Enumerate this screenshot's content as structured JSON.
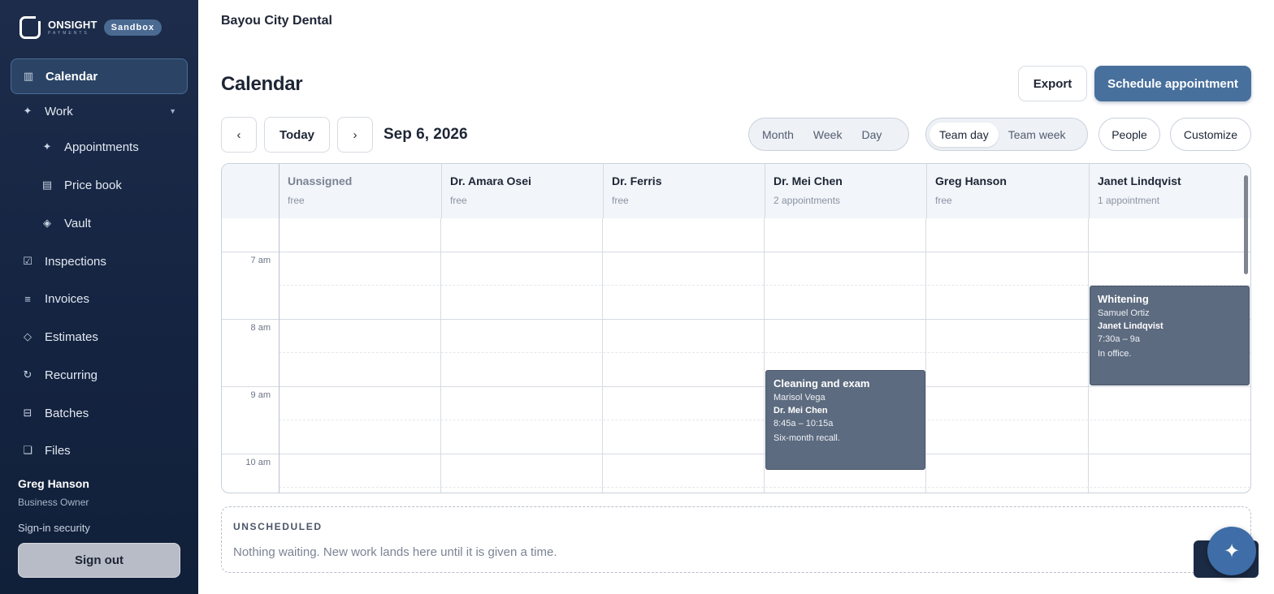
{
  "sidebar": {
    "brand": {
      "name": "ONSIGHT",
      "sub": "PAYMENTS",
      "badge": "Sandbox"
    },
    "items": [
      {
        "label": "Calendar",
        "icon": "calendar-icon"
      },
      {
        "label": "Work",
        "icon": "sparkle-icon"
      },
      {
        "label": "Appointments",
        "icon": "sparkle-icon"
      },
      {
        "label": "Price book",
        "icon": "book-icon"
      },
      {
        "label": "Vault",
        "icon": "diamond-icon"
      },
      {
        "label": "Inspections",
        "icon": "checkbox-icon"
      },
      {
        "label": "Invoices",
        "icon": "list-icon"
      },
      {
        "label": "Estimates",
        "icon": "diamond-outline-icon"
      },
      {
        "label": "Recurring",
        "icon": "refresh-icon"
      },
      {
        "label": "Batches",
        "icon": "batch-icon"
      },
      {
        "label": "Files",
        "icon": "file-icon"
      }
    ],
    "user": {
      "name": "Greg Hanson",
      "role": "Business Owner"
    },
    "sign_in_security": "Sign-in security",
    "sign_out": "Sign out"
  },
  "header": {
    "org": "Bayou City Dental"
  },
  "page": {
    "title": "Calendar",
    "export_label": "Export",
    "schedule_label": "Schedule appointment"
  },
  "toolbar": {
    "prev": "‹",
    "today": "Today",
    "next": "›",
    "date": "Sep 6, 2026",
    "views": [
      "Month",
      "Week",
      "Day"
    ],
    "team_views": [
      "Team day",
      "Team week"
    ],
    "active_team_view": "Team day",
    "people": "People",
    "customize": "Customize"
  },
  "calendar": {
    "columns": [
      {
        "name": "Unassigned",
        "status": "free"
      },
      {
        "name": "Dr. Amara Osei",
        "status": "free"
      },
      {
        "name": "Dr. Ferris",
        "status": "free"
      },
      {
        "name": "Dr. Mei Chen",
        "status": "2 appointments"
      },
      {
        "name": "Greg Hanson",
        "status": "free"
      },
      {
        "name": "Janet Lindqvist",
        "status": "1 appointment"
      }
    ],
    "times": [
      "7 am",
      "8 am",
      "9 am",
      "10 am"
    ],
    "appointments": [
      {
        "title": "Whitening",
        "client": "Samuel Ortiz",
        "provider": "Janet Lindqvist",
        "time": "7:30a – 9a",
        "note": "In office."
      },
      {
        "title": "Cleaning and exam",
        "client": "Marisol Vega",
        "provider": "Dr. Mei Chen",
        "time": "8:45a – 10:15a",
        "note": "Six-month recall."
      }
    ]
  },
  "unscheduled": {
    "heading": "UNSCHEDULED",
    "message": "Nothing waiting. New work lands here until it is given a time."
  },
  "colors": {
    "sidebar_bg": "#152542",
    "accent": "#48709d",
    "event_bg": "#5d6b80"
  }
}
